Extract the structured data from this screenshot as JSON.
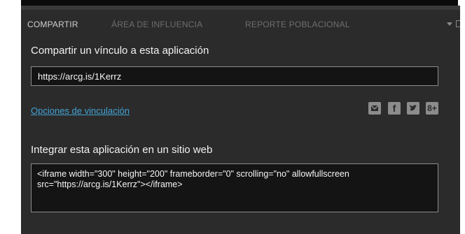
{
  "tabs": [
    {
      "label": "COMPARTIR",
      "active": true
    },
    {
      "label": "ÁREA DE INFLUENCIA",
      "active": false
    },
    {
      "label": "REPORTE POBLACIONAL",
      "active": false
    }
  ],
  "share": {
    "title": "Compartir un vínculo a esta aplicación",
    "url": "https://arcg.is/1Kerrz",
    "options_link": "Opciones de vinculación",
    "social_icons": [
      "mail-icon",
      "facebook-icon",
      "twitter-icon",
      "google-plus-icon"
    ]
  },
  "embed": {
    "title": "Integrar esta aplicación en un sitio web",
    "code": "<iframe width=\"300\" height=\"200\" frameborder=\"0\" scrolling=\"no\" allowfullscreen src=\"https://arcg.is/1Kerrz\"></iframe>"
  },
  "colors": {
    "panel_bg": "#2b2b2b",
    "link": "#43a3d6",
    "active_tab": "#cfcfcf",
    "inactive_tab": "#6e6e6e"
  }
}
